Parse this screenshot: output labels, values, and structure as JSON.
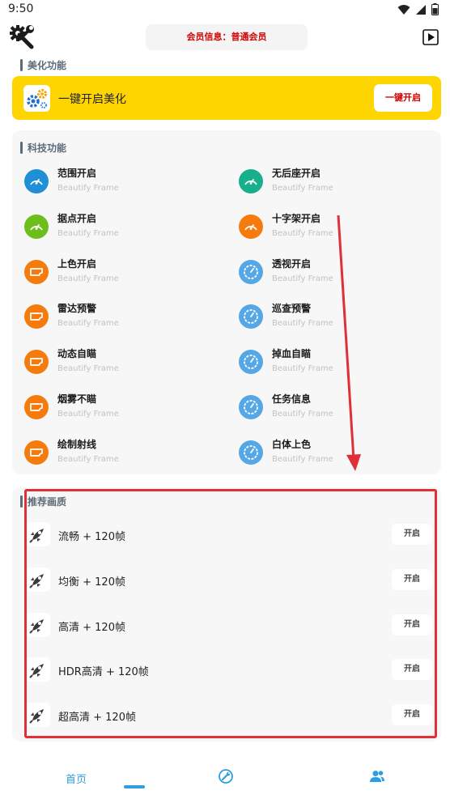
{
  "status_bar": {
    "time": "9:50",
    "icons": [
      "wifi-icon",
      "signal-icon",
      "battery-icon"
    ]
  },
  "header": {
    "member_info": "会员信息：普通会员",
    "left_icon": "wrench-gear-icon",
    "right_icon": "play-icon"
  },
  "beautify": {
    "section_title": "美化功能",
    "label": "一键开启美化",
    "button": "一键开启"
  },
  "tech": {
    "section_title": "科技功能",
    "items": [
      {
        "title": "范围开启",
        "subtitle": "Beautify Frame",
        "color": "#1f8fd6",
        "icon": "gauge-icon"
      },
      {
        "title": "无后座开启",
        "subtitle": "Beautify Frame",
        "color": "#18b08a",
        "icon": "gauge-icon"
      },
      {
        "title": "据点开启",
        "subtitle": "Beautify Frame",
        "color": "#6cbf1a",
        "icon": "gauge-icon"
      },
      {
        "title": "十字架开启",
        "subtitle": "Beautify Frame",
        "color": "#f57c0c",
        "icon": "gauge-icon"
      },
      {
        "title": "上色开启",
        "subtitle": "Beautify Frame",
        "color": "#f57c0c",
        "icon": "card-icon"
      },
      {
        "title": "透视开启",
        "subtitle": "Beautify Frame",
        "color": "#56a7e6",
        "icon": "timer-icon"
      },
      {
        "title": "雷达预警",
        "subtitle": "Beautify Frame",
        "color": "#f57c0c",
        "icon": "card-icon"
      },
      {
        "title": "巡查预警",
        "subtitle": "Beautify Frame",
        "color": "#56a7e6",
        "icon": "timer-icon"
      },
      {
        "title": "动态自瞄",
        "subtitle": "Beautify Frame",
        "color": "#f57c0c",
        "icon": "card-icon"
      },
      {
        "title": "掉血自瞄",
        "subtitle": "Beautify Frame",
        "color": "#56a7e6",
        "icon": "timer-icon"
      },
      {
        "title": "烟雾不瞄",
        "subtitle": "Beautify Frame",
        "color": "#f57c0c",
        "icon": "card-icon"
      },
      {
        "title": "任务信息",
        "subtitle": "Beautify Frame",
        "color": "#56a7e6",
        "icon": "timer-icon"
      },
      {
        "title": "绘制射线",
        "subtitle": "Beautify Frame",
        "color": "#f57c0c",
        "icon": "card-icon"
      },
      {
        "title": "白体上色",
        "subtitle": "Beautify Frame",
        "color": "#56a7e6",
        "icon": "timer-icon"
      }
    ]
  },
  "quality": {
    "section_title": "推荐画质",
    "items": [
      {
        "label": "流畅 + 120帧",
        "button": "开启"
      },
      {
        "label": "均衡 + 120帧",
        "button": "开启"
      },
      {
        "label": "高清 + 120帧",
        "button": "开启"
      },
      {
        "label": "HDR高清 + 120帧",
        "button": "开启"
      },
      {
        "label": "超高清 + 120帧",
        "button": "开启"
      }
    ]
  },
  "bottom_nav": {
    "items": [
      {
        "label": "首页",
        "icon": "",
        "selected": true
      },
      {
        "label": "",
        "icon": "tools-icon",
        "selected": false
      },
      {
        "label": "",
        "icon": "users-icon",
        "selected": false
      }
    ]
  },
  "colors": {
    "accent": "#2e9ee0",
    "yellow": "#ffd500",
    "highlight_red": "#e12f36"
  }
}
